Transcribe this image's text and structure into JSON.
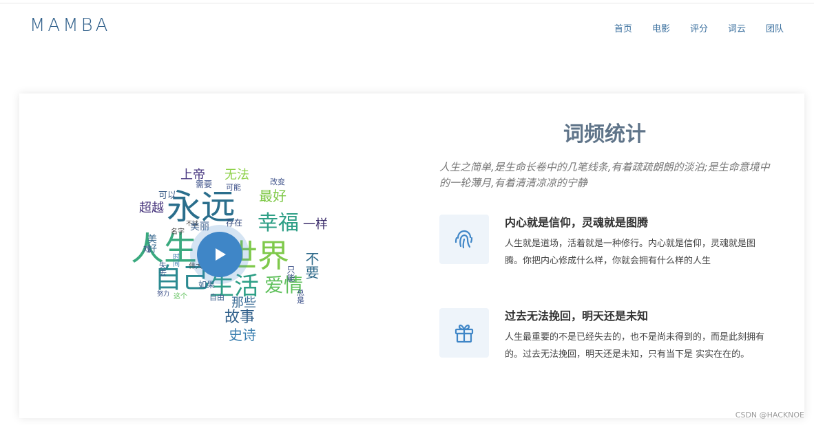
{
  "header": {
    "logo": "MAMBA",
    "nav": [
      "首页",
      "电影",
      "评分",
      "词云",
      "团队"
    ],
    "colors": {
      "logo": "#2f5f8a",
      "nav": "#3a6f9e"
    }
  },
  "wordcloud": {
    "words": [
      "永远",
      "人生",
      "世界",
      "自己",
      "生活",
      "幸福",
      "爱情",
      "故事",
      "史诗",
      "那些",
      "最好",
      "超越",
      "上帝",
      "无法",
      "不要",
      "美丽",
      "存在",
      "一样",
      "可以",
      "美好",
      "需要",
      "可能",
      "改变",
      "如果",
      "自由",
      "只能",
      "总是",
      "不过",
      "名字",
      "时间",
      "失去",
      "这个",
      "戏",
      "努力",
      "伟大"
    ],
    "play_icon": "play-icon"
  },
  "section": {
    "title": "词频统计",
    "intro": "人生之简单,是生命长卷中的几笔线条,有着疏疏朗朗的淡泊;是生命意境中的一轮薄月,有着清清凉凉的宁静",
    "features": [
      {
        "icon": "fingerprint-icon",
        "title": "内心就是信仰，灵魂就是图腾",
        "text": "人生就是道场，活着就是一种修行。内心就是信仰，灵魂就是图腾。你把内心修成什么样，你就会拥有什么样的人生"
      },
      {
        "icon": "gift-icon",
        "title": "过去无法挽回，明天还是未知",
        "text": "人生最重要的不是已经失去的，也不是尚未得到的，而是此刻拥有的。过去无法挽回，明天还是未知，只有当下是 实实在在的。"
      }
    ],
    "colors": {
      "title": "#5f7489",
      "accent": "#3f86c7",
      "icon_bg": "#eef4fa"
    }
  },
  "watermark": "CSDN @HACKNOE"
}
